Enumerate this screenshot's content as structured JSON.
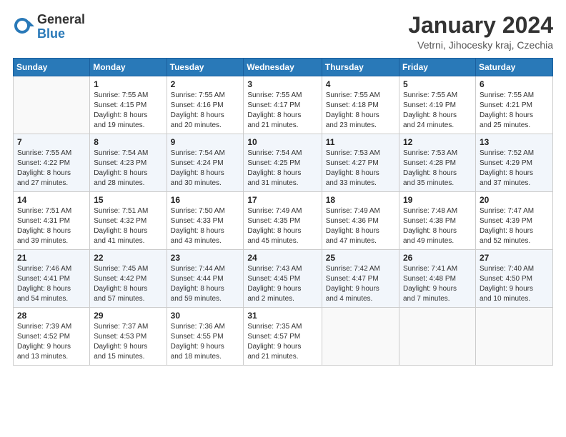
{
  "header": {
    "logo_general": "General",
    "logo_blue": "Blue",
    "month_title": "January 2024",
    "location": "Vetrni, Jihocesky kraj, Czechia"
  },
  "days_of_week": [
    "Sunday",
    "Monday",
    "Tuesday",
    "Wednesday",
    "Thursday",
    "Friday",
    "Saturday"
  ],
  "weeks": [
    [
      {
        "day": "",
        "info": ""
      },
      {
        "day": "1",
        "info": "Sunrise: 7:55 AM\nSunset: 4:15 PM\nDaylight: 8 hours\nand 19 minutes."
      },
      {
        "day": "2",
        "info": "Sunrise: 7:55 AM\nSunset: 4:16 PM\nDaylight: 8 hours\nand 20 minutes."
      },
      {
        "day": "3",
        "info": "Sunrise: 7:55 AM\nSunset: 4:17 PM\nDaylight: 8 hours\nand 21 minutes."
      },
      {
        "day": "4",
        "info": "Sunrise: 7:55 AM\nSunset: 4:18 PM\nDaylight: 8 hours\nand 23 minutes."
      },
      {
        "day": "5",
        "info": "Sunrise: 7:55 AM\nSunset: 4:19 PM\nDaylight: 8 hours\nand 24 minutes."
      },
      {
        "day": "6",
        "info": "Sunrise: 7:55 AM\nSunset: 4:21 PM\nDaylight: 8 hours\nand 25 minutes."
      }
    ],
    [
      {
        "day": "7",
        "info": "Sunrise: 7:55 AM\nSunset: 4:22 PM\nDaylight: 8 hours\nand 27 minutes."
      },
      {
        "day": "8",
        "info": "Sunrise: 7:54 AM\nSunset: 4:23 PM\nDaylight: 8 hours\nand 28 minutes."
      },
      {
        "day": "9",
        "info": "Sunrise: 7:54 AM\nSunset: 4:24 PM\nDaylight: 8 hours\nand 30 minutes."
      },
      {
        "day": "10",
        "info": "Sunrise: 7:54 AM\nSunset: 4:25 PM\nDaylight: 8 hours\nand 31 minutes."
      },
      {
        "day": "11",
        "info": "Sunrise: 7:53 AM\nSunset: 4:27 PM\nDaylight: 8 hours\nand 33 minutes."
      },
      {
        "day": "12",
        "info": "Sunrise: 7:53 AM\nSunset: 4:28 PM\nDaylight: 8 hours\nand 35 minutes."
      },
      {
        "day": "13",
        "info": "Sunrise: 7:52 AM\nSunset: 4:29 PM\nDaylight: 8 hours\nand 37 minutes."
      }
    ],
    [
      {
        "day": "14",
        "info": "Sunrise: 7:51 AM\nSunset: 4:31 PM\nDaylight: 8 hours\nand 39 minutes."
      },
      {
        "day": "15",
        "info": "Sunrise: 7:51 AM\nSunset: 4:32 PM\nDaylight: 8 hours\nand 41 minutes."
      },
      {
        "day": "16",
        "info": "Sunrise: 7:50 AM\nSunset: 4:33 PM\nDaylight: 8 hours\nand 43 minutes."
      },
      {
        "day": "17",
        "info": "Sunrise: 7:49 AM\nSunset: 4:35 PM\nDaylight: 8 hours\nand 45 minutes."
      },
      {
        "day": "18",
        "info": "Sunrise: 7:49 AM\nSunset: 4:36 PM\nDaylight: 8 hours\nand 47 minutes."
      },
      {
        "day": "19",
        "info": "Sunrise: 7:48 AM\nSunset: 4:38 PM\nDaylight: 8 hours\nand 49 minutes."
      },
      {
        "day": "20",
        "info": "Sunrise: 7:47 AM\nSunset: 4:39 PM\nDaylight: 8 hours\nand 52 minutes."
      }
    ],
    [
      {
        "day": "21",
        "info": "Sunrise: 7:46 AM\nSunset: 4:41 PM\nDaylight: 8 hours\nand 54 minutes."
      },
      {
        "day": "22",
        "info": "Sunrise: 7:45 AM\nSunset: 4:42 PM\nDaylight: 8 hours\nand 57 minutes."
      },
      {
        "day": "23",
        "info": "Sunrise: 7:44 AM\nSunset: 4:44 PM\nDaylight: 8 hours\nand 59 minutes."
      },
      {
        "day": "24",
        "info": "Sunrise: 7:43 AM\nSunset: 4:45 PM\nDaylight: 9 hours\nand 2 minutes."
      },
      {
        "day": "25",
        "info": "Sunrise: 7:42 AM\nSunset: 4:47 PM\nDaylight: 9 hours\nand 4 minutes."
      },
      {
        "day": "26",
        "info": "Sunrise: 7:41 AM\nSunset: 4:48 PM\nDaylight: 9 hours\nand 7 minutes."
      },
      {
        "day": "27",
        "info": "Sunrise: 7:40 AM\nSunset: 4:50 PM\nDaylight: 9 hours\nand 10 minutes."
      }
    ],
    [
      {
        "day": "28",
        "info": "Sunrise: 7:39 AM\nSunset: 4:52 PM\nDaylight: 9 hours\nand 13 minutes."
      },
      {
        "day": "29",
        "info": "Sunrise: 7:37 AM\nSunset: 4:53 PM\nDaylight: 9 hours\nand 15 minutes."
      },
      {
        "day": "30",
        "info": "Sunrise: 7:36 AM\nSunset: 4:55 PM\nDaylight: 9 hours\nand 18 minutes."
      },
      {
        "day": "31",
        "info": "Sunrise: 7:35 AM\nSunset: 4:57 PM\nDaylight: 9 hours\nand 21 minutes."
      },
      {
        "day": "",
        "info": ""
      },
      {
        "day": "",
        "info": ""
      },
      {
        "day": "",
        "info": ""
      }
    ]
  ]
}
